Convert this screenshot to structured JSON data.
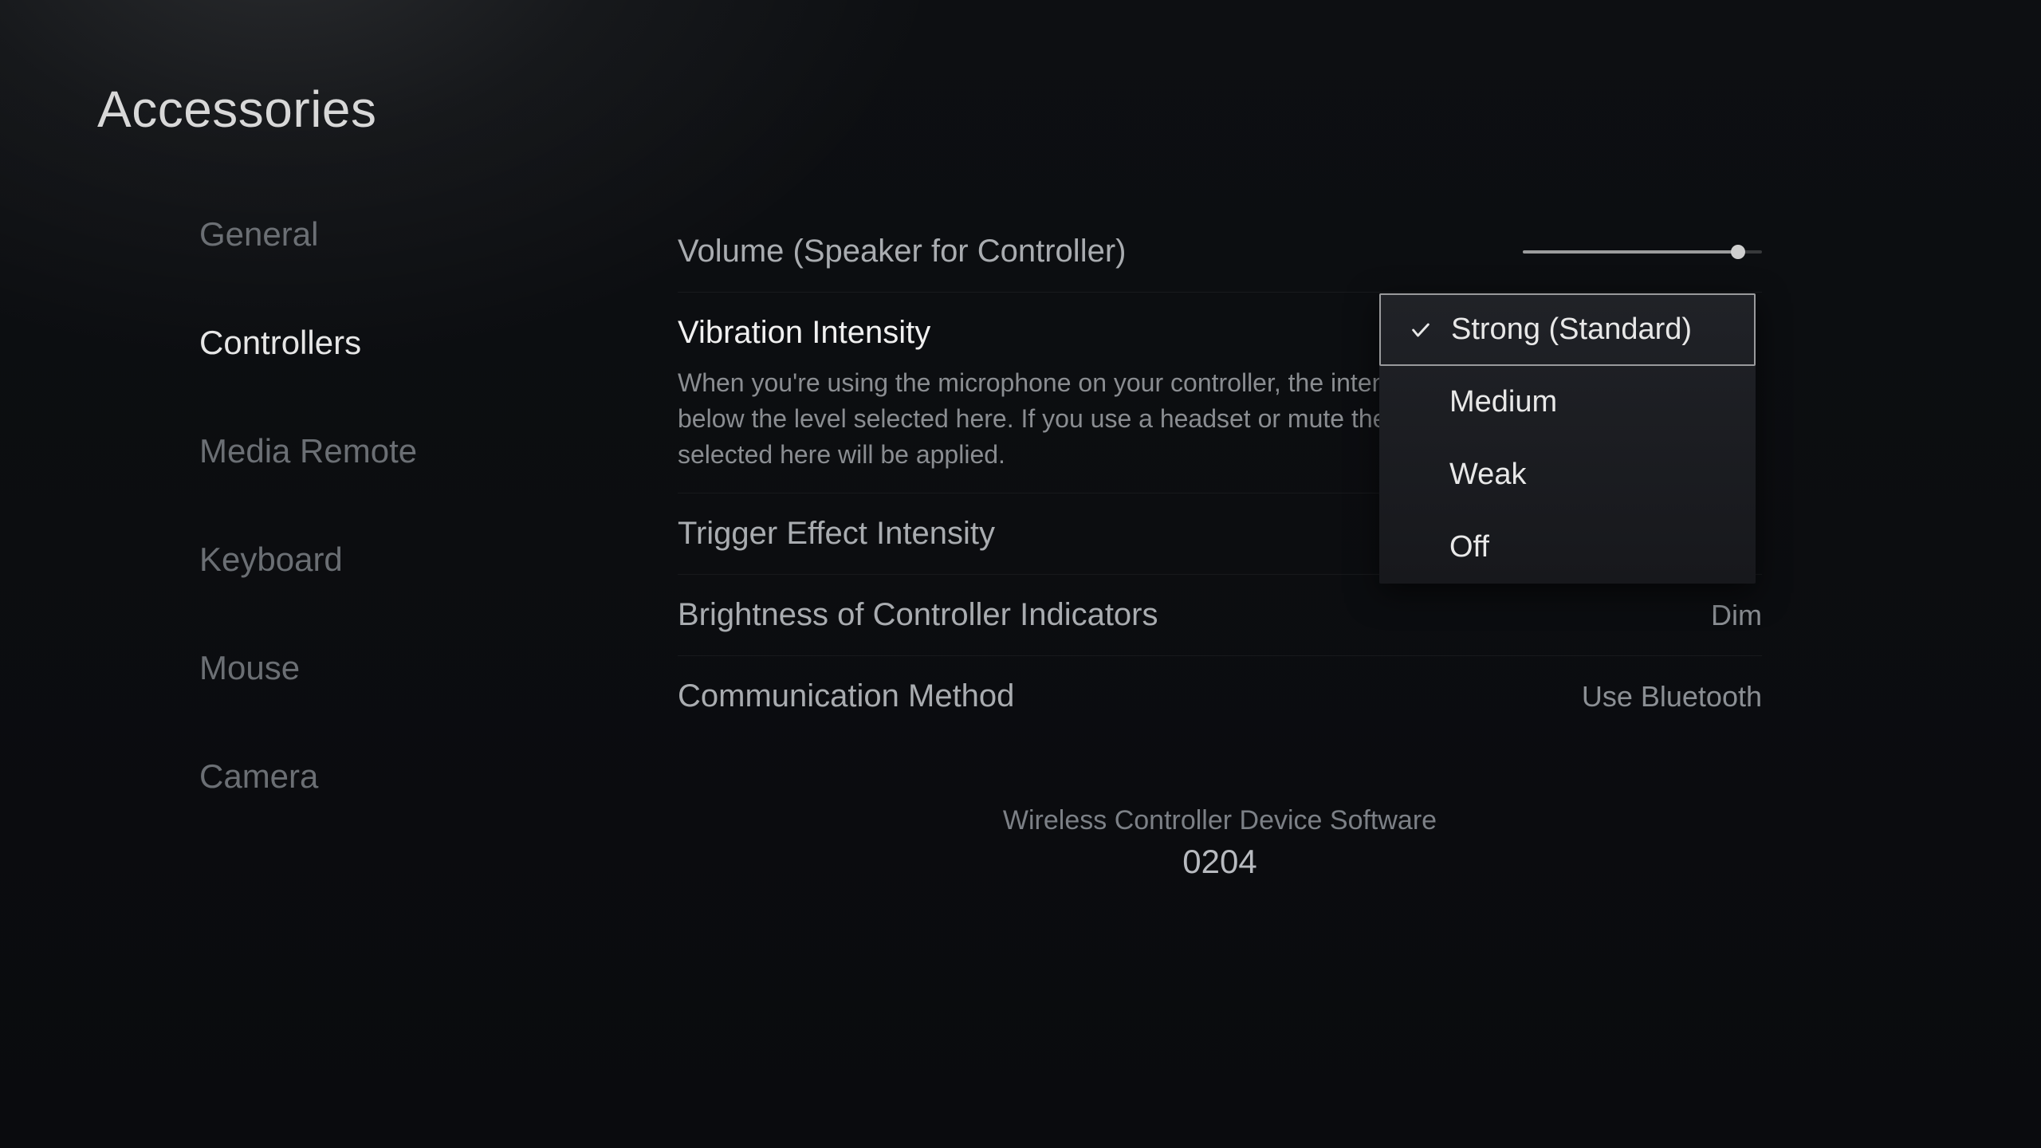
{
  "title": "Accessories",
  "sidebar": {
    "items": [
      {
        "label": "General",
        "active": false
      },
      {
        "label": "Controllers",
        "active": true
      },
      {
        "label": "Media Remote",
        "active": false
      },
      {
        "label": "Keyboard",
        "active": false
      },
      {
        "label": "Mouse",
        "active": false
      },
      {
        "label": "Camera",
        "active": false
      }
    ]
  },
  "settings": {
    "volume": {
      "label": "Volume (Speaker for Controller)",
      "percent": 90
    },
    "vibration": {
      "label": "Vibration Intensity",
      "description": "When you're using the microphone on your controller, the intensity of the vibration is reduced below the level selected here. If you use a headset or mute the microphone, the intensity selected here will be applied.",
      "options": [
        "Strong (Standard)",
        "Medium",
        "Weak",
        "Off"
      ],
      "selected": "Strong (Standard)"
    },
    "trigger": {
      "label": "Trigger Effect Intensity",
      "value": ""
    },
    "brightness": {
      "label": "Brightness of Controller Indicators",
      "value": "Dim"
    },
    "communication": {
      "label": "Communication Method",
      "value": "Use Bluetooth"
    }
  },
  "device": {
    "label": "Wireless Controller Device Software",
    "version": "0204"
  }
}
